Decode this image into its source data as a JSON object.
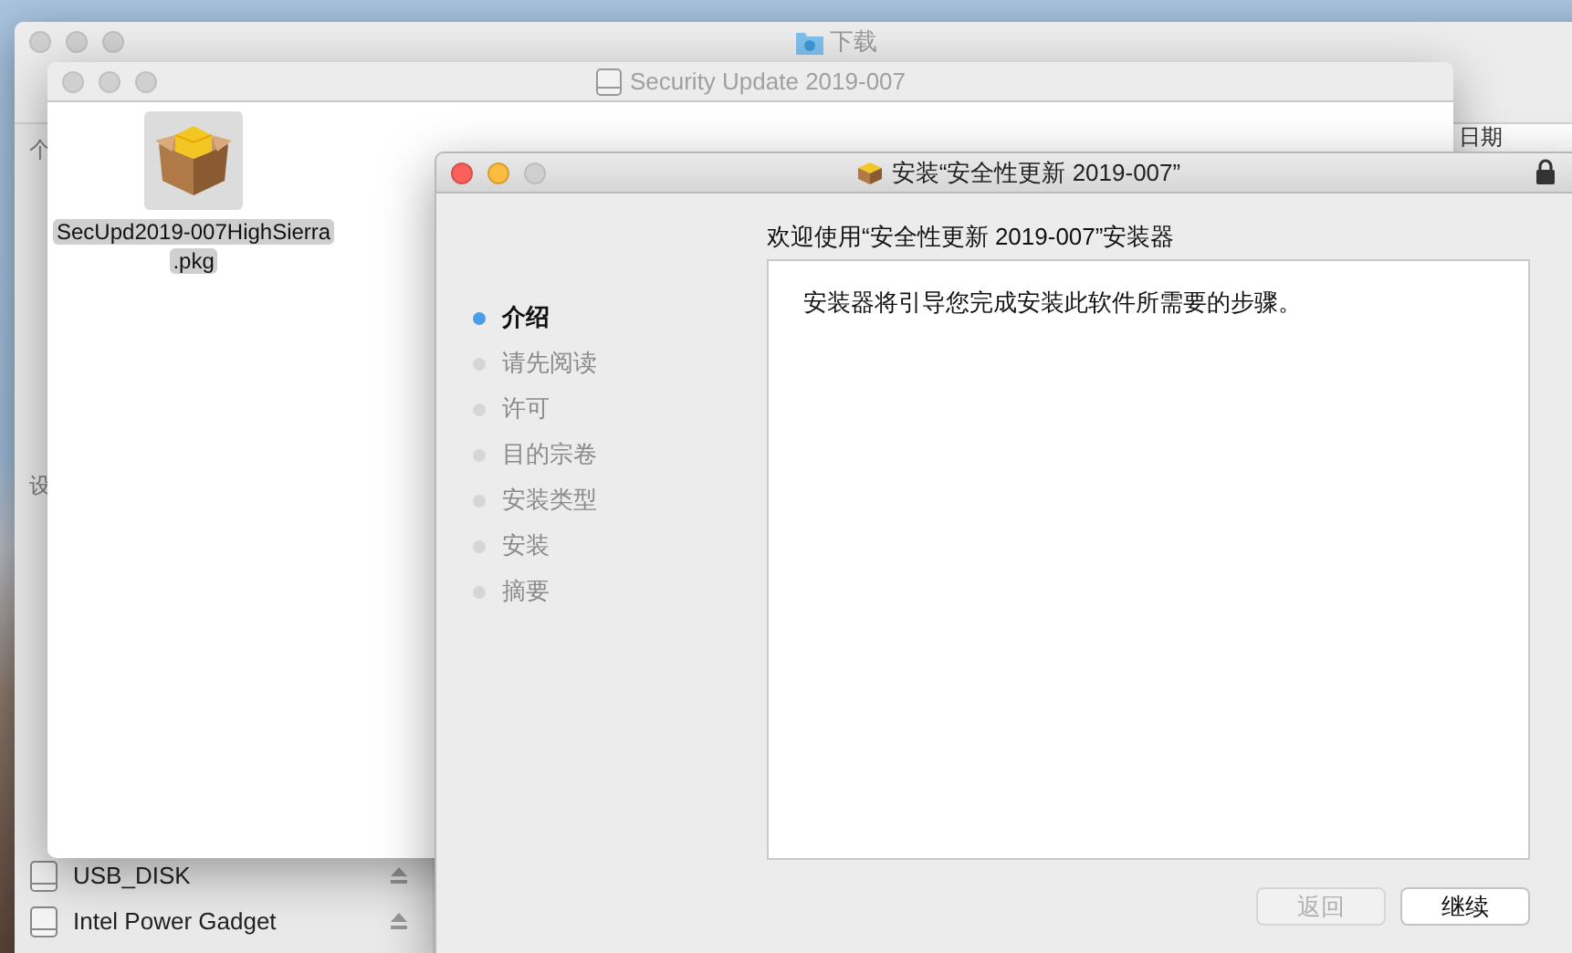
{
  "finder_window": {
    "title": "下载",
    "active": false,
    "sidebar_headings": [
      "个",
      "设"
    ],
    "column_header": "日期",
    "devices": [
      {
        "name": "USB_DISK"
      },
      {
        "name": "Intel Power Gadget"
      }
    ]
  },
  "volume_window": {
    "title": "Security Update 2019-007",
    "active": false,
    "files": [
      {
        "name": "SecUpd2019-007HighSierra.pkg",
        "selected": true
      }
    ]
  },
  "installer_window": {
    "title": "安装“安全性更新 2019-007”",
    "active": true,
    "steps": [
      {
        "label": "介绍",
        "selected": true
      },
      {
        "label": "请先阅读",
        "selected": false
      },
      {
        "label": "许可",
        "selected": false
      },
      {
        "label": "目的宗卷",
        "selected": false
      },
      {
        "label": "安装类型",
        "selected": false
      },
      {
        "label": "安装",
        "selected": false
      },
      {
        "label": "摘要",
        "selected": false
      }
    ],
    "heading": "欢迎使用“安全性更新 2019-007”安装器",
    "body": "安装器将引导您完成安装此软件所需要的步骤。",
    "buttons": [
      {
        "label": "返回",
        "disabled": true
      },
      {
        "label": "继续",
        "disabled": false
      }
    ]
  }
}
